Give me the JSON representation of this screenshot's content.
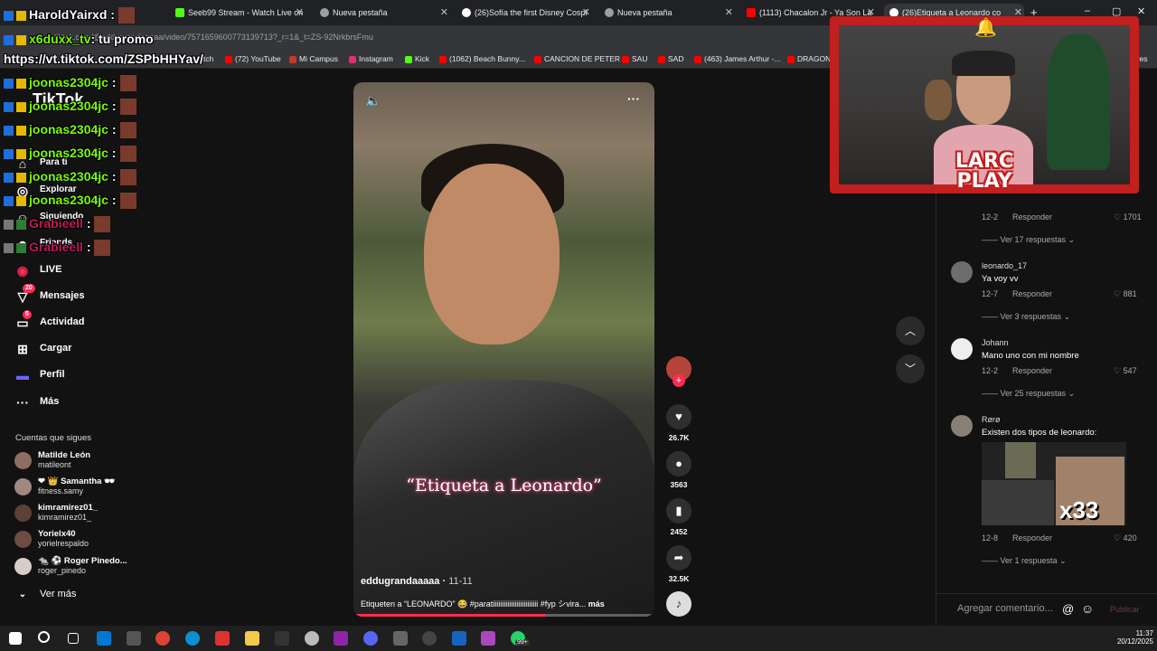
{
  "browser": {
    "tabs": [
      {
        "label": "Seeb99 Stream - Watch Live on",
        "color": "#53fc18"
      },
      {
        "label": "Nueva pestaña",
        "color": "#9aa0a6"
      },
      {
        "label": "(26)Sofía the first Disney Cospl",
        "color": "#ffffff"
      },
      {
        "label": "Nueva pestaña",
        "color": "#9aa0a6"
      },
      {
        "label": "(1113) Chacalon Jr - Ya Son La",
        "color": "#ff0000"
      },
      {
        "label": "(26)Etiqueta a Leonardo co",
        "color": "#ffffff"
      }
    ],
    "url": "tiktok.com/@eddugrandaaaaa/video/7571659600773139713?_r=1&_t=ZS-92NrkbrsFmu",
    "bookmarks": [
      {
        "label": "witch",
        "color": "#9146ff"
      },
      {
        "label": "(72) YouTube",
        "color": "#ff0000"
      },
      {
        "label": "Mi Campus",
        "color": "#c0392b"
      },
      {
        "label": "Instagram",
        "color": "#e1306c"
      },
      {
        "label": "Kick",
        "color": "#53fc18"
      },
      {
        "label": "(1062) Beach Bunny...",
        "color": "#ff0000"
      },
      {
        "label": "CANCION DE PETER",
        "color": "#ff0000"
      },
      {
        "label": "SAU",
        "color": "#ff0000"
      },
      {
        "label": "SAD",
        "color": "#ff0000"
      },
      {
        "label": "(463) James Arthur -...",
        "color": "#ff0000"
      },
      {
        "label": "DRAGON B",
        "color": "#ff0000"
      },
      {
        "label": "ores",
        "color": "#9aa0a6"
      }
    ]
  },
  "sidebar": {
    "logo": "TikTok",
    "nav": [
      {
        "label": "Para ti",
        "icon": "home-icon"
      },
      {
        "label": "Explorar",
        "icon": "compass-icon"
      },
      {
        "label": "Siguiendo",
        "icon": "following-icon"
      },
      {
        "label": "Friends",
        "icon": "friends-icon"
      },
      {
        "label": "LIVE",
        "icon": "live-icon"
      },
      {
        "label": "Mensajes",
        "icon": "messages-icon",
        "badge": "20"
      },
      {
        "label": "Actividad",
        "icon": "activity-icon",
        "badge": "5"
      },
      {
        "label": "Cargar",
        "icon": "upload-icon"
      },
      {
        "label": "Perfil",
        "icon": "profile-icon"
      },
      {
        "label": "Más",
        "icon": "more-icon"
      }
    ],
    "following_title": "Cuentas que sigues",
    "following": [
      {
        "name": "Matilde León",
        "handle": "matileont",
        "color": "#8d6e63"
      },
      {
        "name": "❤ 👑 Samantha 🕶",
        "handle": "fitness.samy",
        "color": "#a1887f"
      },
      {
        "name": "kimramirez01_",
        "handle": "kimramirez01_",
        "color": "#5d4037"
      },
      {
        "name": "Yorielx40",
        "handle": "yorielrespaldo",
        "color": "#6d4c41"
      },
      {
        "name": "🐀 ⚽ Roger Pinedo...",
        "handle": "roger_pinedo",
        "color": "#d7ccc8"
      }
    ],
    "see_more": "Ver más"
  },
  "video": {
    "overlay_text": "“Etiqueta a Leonardo”",
    "author": "eddugrandaaaaa",
    "date": "11-11",
    "description": "Etiqueten a “LEONARDO” 😂 #paratiiiiiiiiiiiiiiiiiiiiiiiii #fyp シvira...",
    "more_label": "más",
    "progress": 0.64,
    "likes": "26.7K",
    "comments": "3563",
    "saves": "2452",
    "shares": "32.5K"
  },
  "comments": {
    "items": [
      {
        "date": "12-2",
        "reply_label": "Responder",
        "likes": "1701",
        "replies": "Ver 17 respuestas"
      },
      {
        "user": "leonardo_17",
        "text": "Ya voy vv",
        "date": "12-7",
        "reply_label": "Responder",
        "likes": "881",
        "replies": "Ver 3 respuestas",
        "color": "#6d6d6d"
      },
      {
        "user": "Johann",
        "text": "Mano uno con mi nombre",
        "date": "12-2",
        "reply_label": "Responder",
        "likes": "547",
        "replies": "Ver 25 respuestas",
        "color": "#eeeeee"
      },
      {
        "user": "Rørø",
        "text": "Existen dos tipos de leonardo:",
        "date": "12-8",
        "reply_label": "Responder",
        "likes": "420",
        "replies": "Ver 1 respuesta",
        "color": "#8a7f76"
      }
    ],
    "input_placeholder": "Agregar comentario...",
    "post_label": "Publicar",
    "sticker_text": "x33"
  },
  "stream_chat": [
    {
      "user": "HaroldYairxd",
      "text": ":",
      "color": "#ffffff"
    },
    {
      "user": "x6duxx_tv",
      "text": ": tu promo",
      "color": "#7cfc00"
    },
    {
      "user": "https://vt.tiktok.com/ZSPbHHYav/",
      "text": "",
      "color": "#ffffff"
    },
    {
      "user": "joonas2304jc",
      "text": ":",
      "color": "#7cfc00"
    },
    {
      "user": "joonas2304jc",
      "text": ":",
      "color": "#7cfc00"
    },
    {
      "user": "joonas2304jc",
      "text": ":",
      "color": "#7cfc00"
    },
    {
      "user": "joonas2304jc",
      "text": ":",
      "color": "#7cfc00"
    },
    {
      "user": "joonas2304jc",
      "text": ":",
      "color": "#7cfc00"
    },
    {
      "user": "joonas2304jc",
      "text": ":",
      "color": "#7cfc00"
    },
    {
      "user": "Grabieell",
      "text": ":",
      "color": "#c2185b"
    },
    {
      "user": "Grabieell",
      "text": ":",
      "color": "#c2185b"
    }
  ],
  "webcam": {
    "overlay_line1": "LARC",
    "overlay_line2": "PLAY"
  },
  "taskbar": {
    "time": "11:37",
    "date": "20/12/2025",
    "badge": "99+"
  }
}
